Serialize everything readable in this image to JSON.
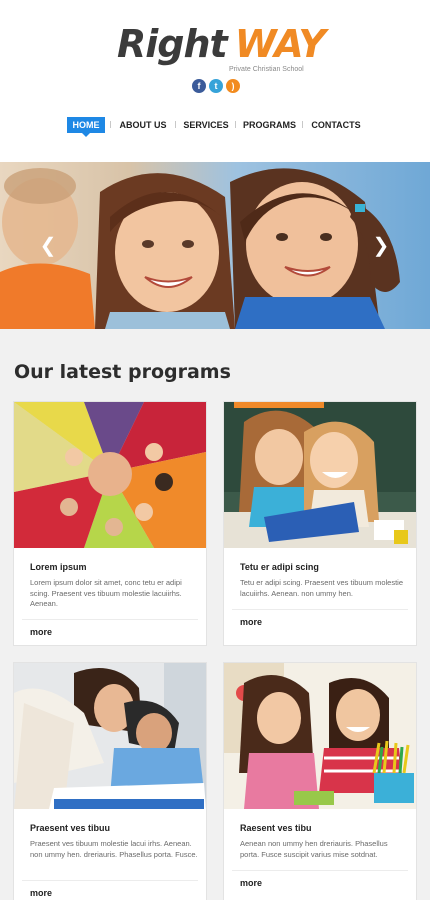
{
  "header": {
    "logo_right": "Right",
    "logo_way": "WAY",
    "tagline": "Private Christian School",
    "social": [
      {
        "name": "facebook-icon",
        "glyph": "f",
        "color": "#3b5b9a"
      },
      {
        "name": "twitter-icon",
        "glyph": "t",
        "color": "#36a3d9"
      },
      {
        "name": "rss-icon",
        "glyph": ")",
        "color": "#f28b1f"
      }
    ]
  },
  "nav": {
    "items": [
      "HOME",
      "ABOUT US",
      "SERVICES",
      "PROGRAMS",
      "CONTACTS"
    ],
    "active": "HOME",
    "accent": "#1e88e5"
  },
  "hero": {
    "prev": "❮",
    "next": "❯"
  },
  "programs": {
    "title": "Our latest programs",
    "cards": [
      {
        "title": "Lorem ipsum",
        "text": "Lorem ipsum dolor sit amet, conc tetu er adipi scing. Praesent ves tibuum molestie lacuiirhs. Aenean.",
        "more": "more"
      },
      {
        "title": "Tetu er adipi scing",
        "text": "Tetu er adipi scing. Praesent ves tibuum molestie lacuiirhs. Aenean. non ummy hen.",
        "more": "more"
      },
      {
        "title": "Praesent ves tibuu",
        "text": "Praesent ves tibuum molestie lacui irhs. Aenean. non ummy hen. dreriauris. Phasellus porta. Fusce.",
        "more": "more"
      },
      {
        "title": "Raesent ves tibu",
        "text": "Aenean non ummy hen dreriauris. Phasellus porta. Fusce suscipit varius mise sotdnat.",
        "more": "more"
      }
    ]
  }
}
